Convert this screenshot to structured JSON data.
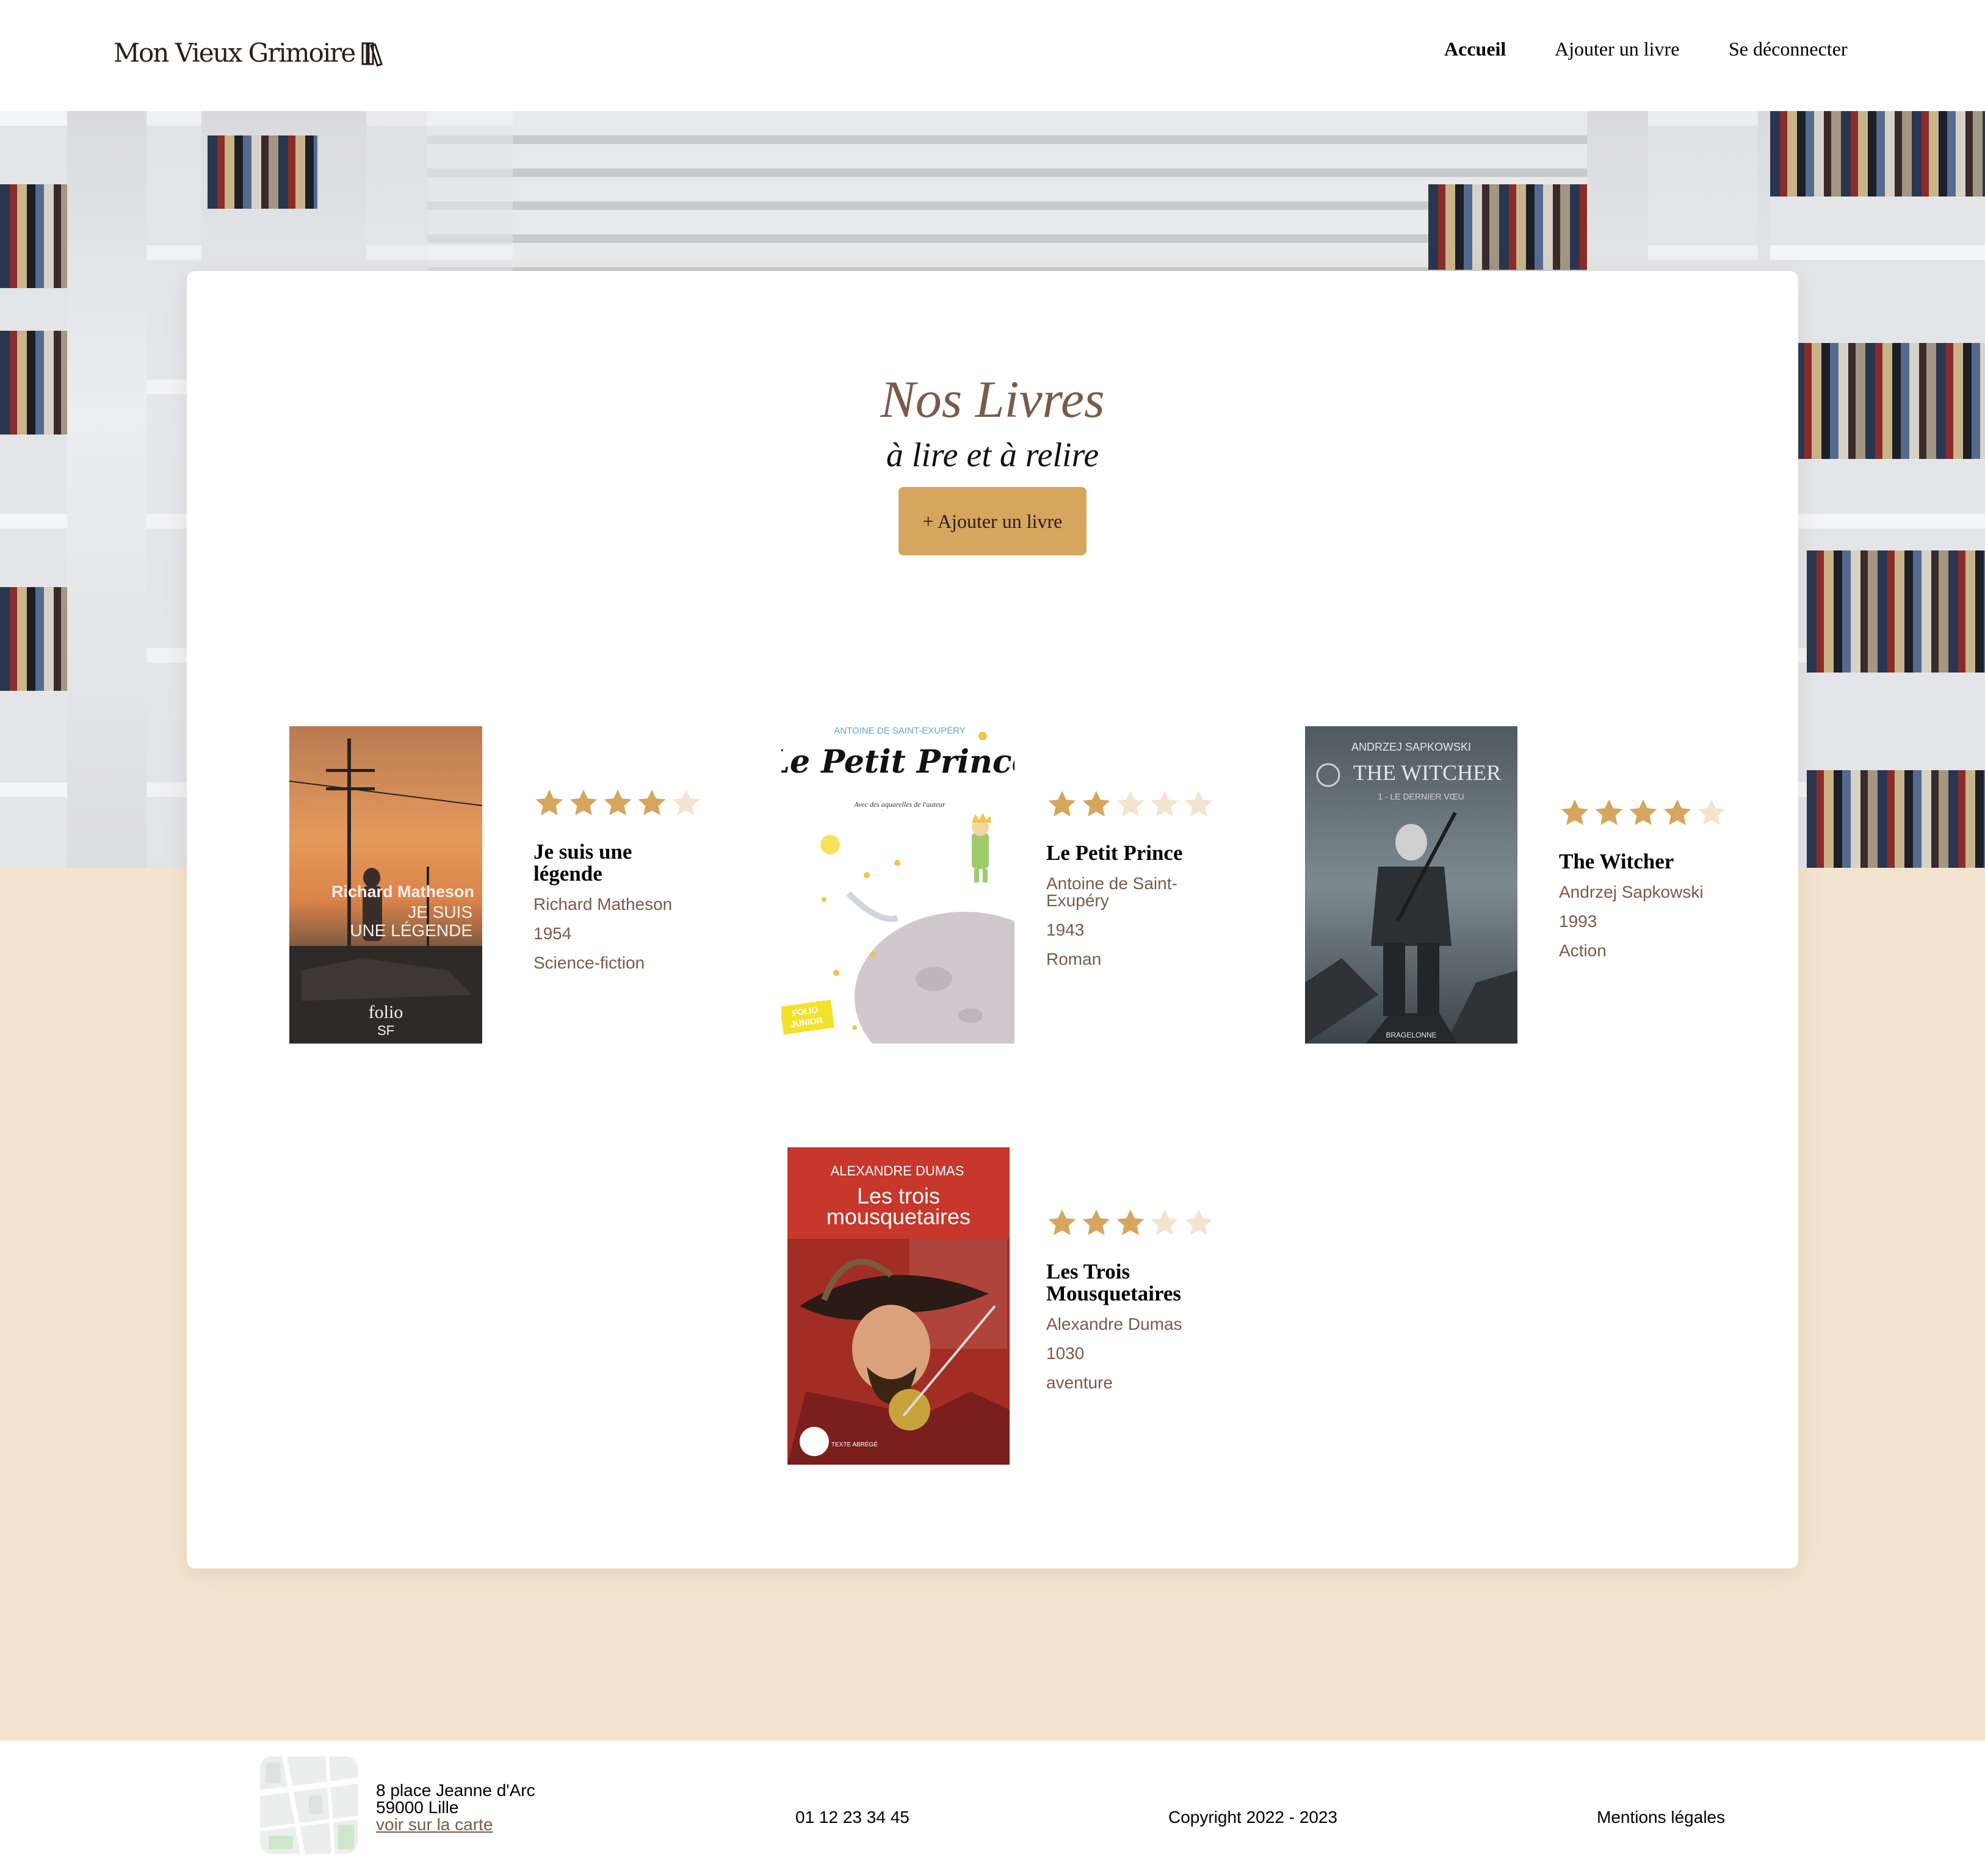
{
  "header": {
    "logo_text": "Mon Vieux Grimoire",
    "nav": {
      "home": "Accueil",
      "add_book": "Ajouter un livre",
      "logout": "Se déconnecter"
    }
  },
  "main": {
    "title": "Nos Livres",
    "subtitle": "à lire et à relire",
    "add_button": "+ Ajouter un livre"
  },
  "books": [
    {
      "title": "Je suis une légende",
      "title_line1": "Je suis une",
      "title_line2": "légende",
      "author": "Richard Matheson",
      "year": "1954",
      "genre": "Science-fiction",
      "rating": 4,
      "cover": {
        "line1": "Richard Matheson",
        "line2": "JE SUIS",
        "line3": "UNE LÉGENDE",
        "brand1": "folio",
        "brand2": "SF"
      }
    },
    {
      "title": "Le Petit Prince",
      "author": "Antoine de Saint-Exupéry",
      "author_line1": "Antoine de Saint-",
      "author_line2": "Exupéry",
      "year": "1943",
      "genre": "Roman",
      "rating": 2,
      "cover": {
        "author": "ANTOINE DE SAINT-EXUPÉRY",
        "title": "Le Petit Prince",
        "tagline": "Avec des aquarelles de l'auteur",
        "badge1": "FOLIO",
        "badge2": "JUNIOR"
      }
    },
    {
      "title": "The Witcher",
      "author": "Andrzej Sapkowski",
      "year": "1993",
      "genre": "Action",
      "rating": 4,
      "cover": {
        "author": "ANDRZEJ SAPKOWSKI",
        "title": "THE WITCHER",
        "subtitle": "1 - LE DERNIER VŒU",
        "publisher": "BRAGELONNE"
      }
    },
    {
      "title": "Les Trois Mousquetaires",
      "title_line1": "Les Trois",
      "title_line2": "Mousquetaires",
      "author": "Alexandre Dumas",
      "year": "1030",
      "genre": "aventure",
      "rating": 3,
      "cover": {
        "author": "ALEXANDRE DUMAS",
        "title_line1": "Les trois",
        "title_line2": "mousquetaires",
        "badge": "TEXTE ABRÉGÉ"
      }
    }
  ],
  "footer": {
    "address_line1": "8 place Jeanne d'Arc",
    "address_line2": "59000 Lille",
    "map_link": "voir sur la carte",
    "phone": "01 12 23 34 45",
    "copyright": "Copyright 2022 - 2023",
    "legal": "Mentions légales"
  },
  "colors": {
    "brand": "#7b5a4a",
    "accent": "#d6a55e",
    "star_filled": "#d6a55e",
    "star_empty": "#f2e4cf",
    "page_background": "#f2e4cf"
  },
  "icons": {
    "logo": "books-icon",
    "rating": "star-icon",
    "map": "map-thumbnail"
  }
}
